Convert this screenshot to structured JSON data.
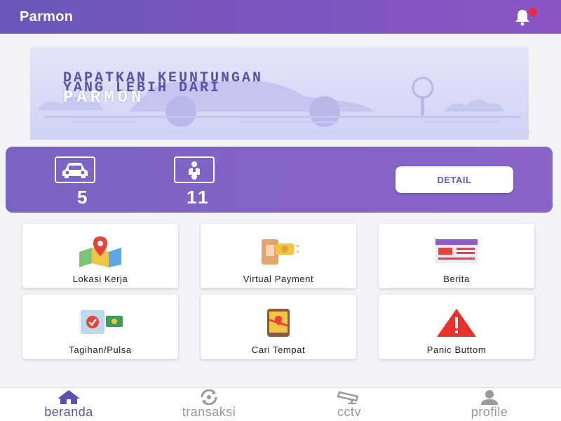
{
  "appbar": {
    "title": "Parmon"
  },
  "banner": {
    "line1": "DAPATKAN KEUNTUNGAN",
    "line2": "YANG LEBIH DARI",
    "brand": "PARMON"
  },
  "stats": {
    "car_count": "5",
    "motor_count": "11",
    "detail_label": "DETAIL"
  },
  "menu": [
    {
      "label": "Lokasi Kerja",
      "icon": "map-pin-icon"
    },
    {
      "label": "Virtual Payment",
      "icon": "payment-card-icon"
    },
    {
      "label": "Berita",
      "icon": "news-icon"
    },
    {
      "label": "Tagihan/Pulsa",
      "icon": "bill-phone-icon"
    },
    {
      "label": "Cari Tempat",
      "icon": "find-place-icon"
    },
    {
      "label": "Panic Buttom",
      "icon": "warning-icon"
    }
  ],
  "bottom_nav": [
    {
      "label": "beranda",
      "icon": "home-icon",
      "active": true
    },
    {
      "label": "transaksi",
      "icon": "refresh-money-icon",
      "active": false
    },
    {
      "label": "cctv",
      "icon": "cctv-icon",
      "active": false
    },
    {
      "label": "profile",
      "icon": "person-icon",
      "active": false
    }
  ],
  "colors": {
    "primary": "#7b5fc4",
    "accent_text": "#5f4fb0",
    "notification": "#f0263a"
  }
}
